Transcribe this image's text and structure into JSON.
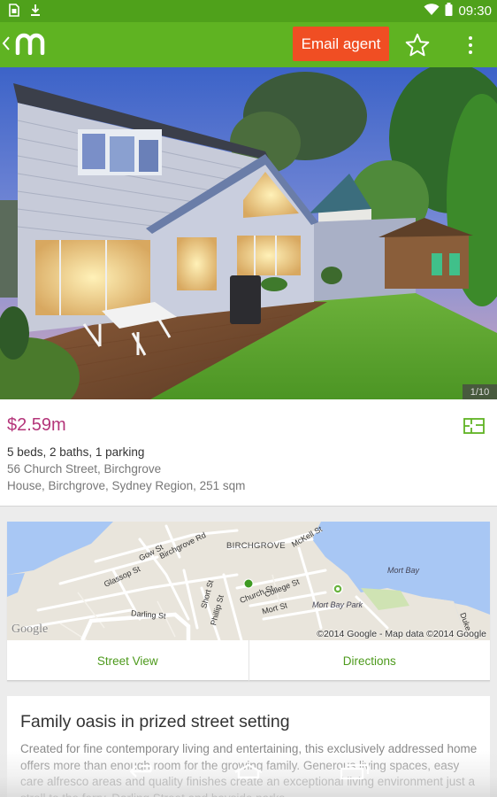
{
  "status_bar": {
    "time": "09:30",
    "icons": [
      "sim-card-icon",
      "download-icon",
      "wifi-icon",
      "battery-icon"
    ]
  },
  "app_bar": {
    "logo": "m",
    "email_agent_label": "Email agent",
    "colors": {
      "bar": "#5fb322",
      "status": "#4fa11b",
      "email_button": "#f04e23"
    }
  },
  "gallery": {
    "counter": "1/10"
  },
  "listing": {
    "price": "$2.59m",
    "features": "5 beds, 2 baths, 1 parking",
    "address": "56 Church Street, Birchgrove",
    "details": "House, Birchgrove, Sydney Region, 251 sqm",
    "price_color": "#b4357a"
  },
  "map": {
    "labels": {
      "gow": "Gow St",
      "birchgrove_rd": "Birchgrove Rd",
      "glassop": "Glassop St",
      "birchgrove": "BIRCHGROVE",
      "mckell": "McKell St",
      "mort_bay": "Mort Bay",
      "short": "Short St",
      "phillip": "Phillip St",
      "church": "Church St",
      "college": "College St",
      "mort_st": "Mort St",
      "mort_bay_park": "Mort Bay Park",
      "darling": "Darling St",
      "duke": "Duke"
    },
    "google_logo": "Google",
    "copyright": "©2014 Google - Map data ©2014 Google",
    "street_view_label": "Street View",
    "directions_label": "Directions"
  },
  "description": {
    "title": "Family oasis in prized street setting",
    "body": "Created for fine contemporary living and entertaining, this exclusively addressed home offers more than enough room for the growing family. Generous living spaces, easy care alfresco areas and quality finishes create an exceptional living environment just a stroll to the ferry, Darling Street and bayside parks."
  },
  "nav_bar": {
    "buttons": [
      "back-nav-icon",
      "home-nav-icon",
      "recents-nav-icon"
    ]
  }
}
